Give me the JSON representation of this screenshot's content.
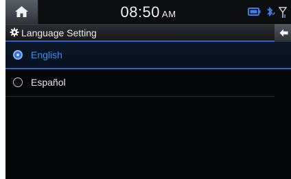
{
  "status_bar": {
    "time": "08:50",
    "ampm": "AM",
    "home_icon": "home-icon",
    "icons": [
      "battery-icon",
      "bluetooth-icon",
      "signal-icon"
    ]
  },
  "header": {
    "title": "Language Setting",
    "title_icon": "gear-icon",
    "back_icon": "back-arrow-icon"
  },
  "languages": [
    {
      "label": "English",
      "selected": true
    },
    {
      "label": "Español",
      "selected": false
    }
  ],
  "colors": {
    "accent": "#2b63c9",
    "selected_text": "#3f8df0",
    "background": "#050607"
  }
}
